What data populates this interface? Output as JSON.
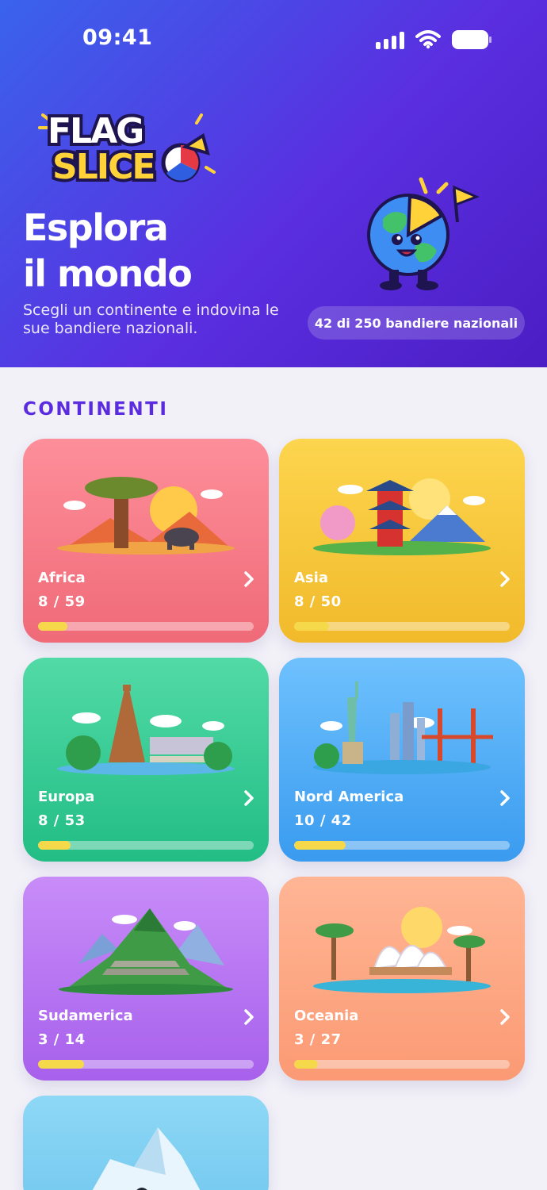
{
  "status_bar": {
    "time": "09:41"
  },
  "hero": {
    "logo_line1": "FLAG",
    "logo_line2": "SLICE",
    "title_line1": "Esplora",
    "title_line2": "il mondo",
    "subtitle": "Scegli un continente e indovina le sue bandiere nazionali.",
    "progress_pill": "42 di 250 bandiere nazionali",
    "mascot_icon": "globe-mascot-icon"
  },
  "section": {
    "title": "CONTINENTI"
  },
  "colors": {
    "accent": "#5b2be0",
    "progress_fill": "#f6d84b",
    "hero_gradient_start": "#3a63ec",
    "hero_gradient_end": "#4b1dc4"
  },
  "continents": [
    {
      "id": "africa",
      "name": "Africa",
      "count": "8 / 59",
      "progress": 0.136,
      "art_icon": "baobab-elephant-savanna-icon"
    },
    {
      "id": "asia",
      "name": "Asia",
      "count": "8 / 50",
      "progress": 0.16,
      "art_icon": "pagoda-mount-fuji-icon"
    },
    {
      "id": "europa",
      "name": "Europa",
      "count": "8 / 53",
      "progress": 0.151,
      "art_icon": "eiffel-tower-bridge-icon"
    },
    {
      "id": "nordamerica",
      "name": "Nord America",
      "count": "10 / 42",
      "progress": 0.238,
      "art_icon": "statue-of-liberty-golden-gate-icon"
    },
    {
      "id": "sudamerica",
      "name": "Sudamerica",
      "count": "3 / 14",
      "progress": 0.214,
      "art_icon": "machu-picchu-icon"
    },
    {
      "id": "oceania",
      "name": "Oceania",
      "count": "3 / 27",
      "progress": 0.111,
      "art_icon": "sydney-opera-house-icon"
    },
    {
      "id": "antartide",
      "art_icon": "iceberg-penguins-icon"
    }
  ]
}
